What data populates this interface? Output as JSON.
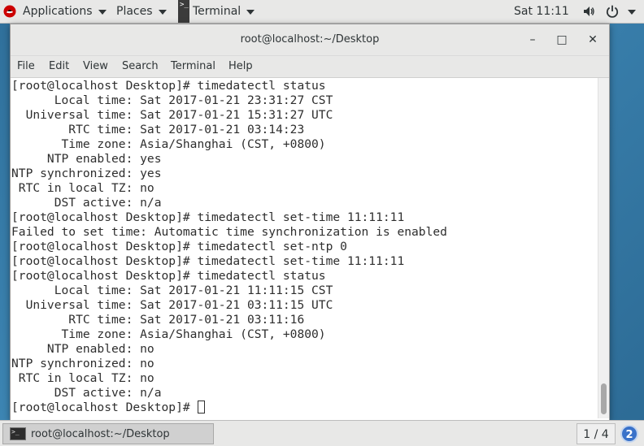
{
  "topbar": {
    "applications_label": "Applications",
    "places_label": "Places",
    "terminal_label": "Terminal",
    "clock": "Sat 11:11",
    "icons": [
      "redhat-icon",
      "volume-icon",
      "power-icon",
      "chevron-down-icon"
    ]
  },
  "window": {
    "title": "root@localhost:~/Desktop",
    "minimize": "–",
    "maximize": "□",
    "close": "✕",
    "menu": [
      "File",
      "Edit",
      "View",
      "Search",
      "Terminal",
      "Help"
    ]
  },
  "terminal": {
    "lines": [
      "[root@localhost Desktop]# timedatectl status",
      "      Local time: Sat 2017-01-21 23:31:27 CST",
      "  Universal time: Sat 2017-01-21 15:31:27 UTC",
      "        RTC time: Sat 2017-01-21 03:14:23",
      "       Time zone: Asia/Shanghai (CST, +0800)",
      "     NTP enabled: yes",
      "NTP synchronized: yes",
      " RTC in local TZ: no",
      "      DST active: n/a",
      "[root@localhost Desktop]# timedatectl set-time 11:11:11",
      "Failed to set time: Automatic time synchronization is enabled",
      "[root@localhost Desktop]# timedatectl set-ntp 0",
      "[root@localhost Desktop]# timedatectl set-time 11:11:11",
      "[root@localhost Desktop]# timedatectl status",
      "      Local time: Sat 2017-01-21 11:11:15 CST",
      "  Universal time: Sat 2017-01-21 03:11:15 UTC",
      "        RTC time: Sat 2017-01-21 03:11:16",
      "       Time zone: Asia/Shanghai (CST, +0800)",
      "     NTP enabled: no",
      "NTP synchronized: no",
      " RTC in local TZ: no",
      "      DST active: n/a",
      "[root@localhost Desktop]# "
    ]
  },
  "taskbar": {
    "window_label": "root@localhost:~/Desktop",
    "workspace": "1 / 4",
    "notifications": "2"
  }
}
